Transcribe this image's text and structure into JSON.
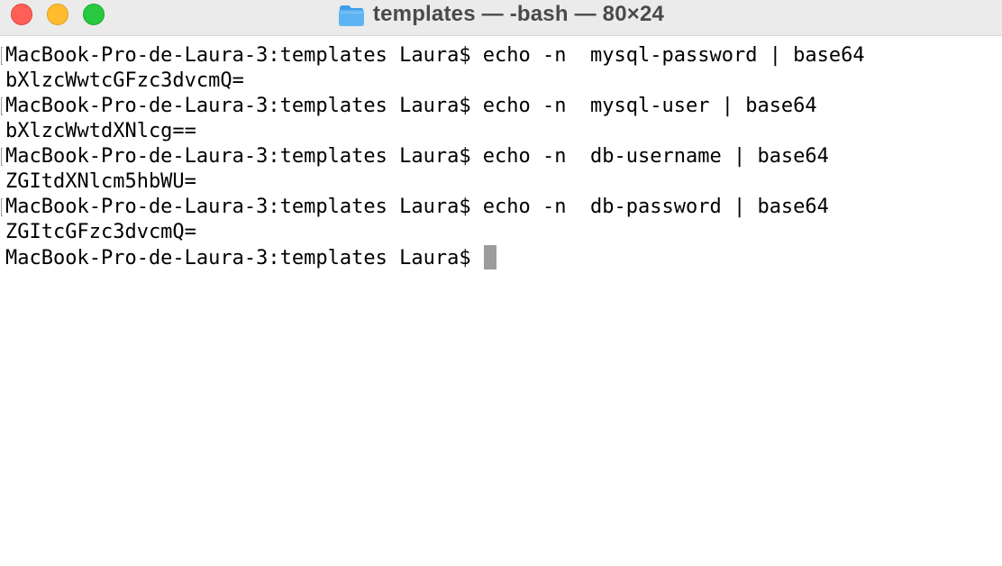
{
  "window": {
    "title": "templates — -bash — 80×24",
    "icon": "folder-icon"
  },
  "terminal": {
    "lines": [
      {
        "kind": "command",
        "text": "MacBook-Pro-de-Laura-3:templates Laura$ echo -n  mysql-password | base64"
      },
      {
        "kind": "output",
        "text": "bXlzcWwtcGFzc3dvcmQ="
      },
      {
        "kind": "command",
        "text": "MacBook-Pro-de-Laura-3:templates Laura$ echo -n  mysql-user | base64"
      },
      {
        "kind": "output",
        "text": "bXlzcWwtdXNlcg=="
      },
      {
        "kind": "command",
        "text": "MacBook-Pro-de-Laura-3:templates Laura$ echo -n  db-username | base64"
      },
      {
        "kind": "output",
        "text": "ZGItdXNlcm5hbWU="
      },
      {
        "kind": "command",
        "text": "MacBook-Pro-de-Laura-3:templates Laura$ echo -n  db-password | base64"
      },
      {
        "kind": "output",
        "text": "ZGItcGFzc3dvcmQ="
      }
    ],
    "prompt": "MacBook-Pro-de-Laura-3:templates Laura$"
  },
  "colors": {
    "close": "#ff5f57",
    "minimize": "#febc2e",
    "zoom": "#28c840",
    "cursor": "#9c9c9c",
    "folder": "#5eb4f2"
  }
}
